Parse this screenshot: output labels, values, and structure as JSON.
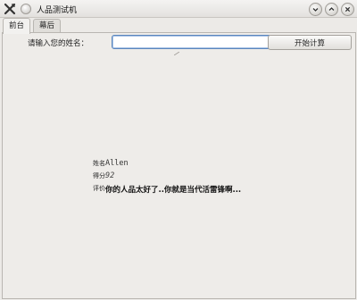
{
  "window": {
    "title": "人品测试机",
    "icons": {
      "app": "x-tools-icon",
      "menu": "menu-dot-icon",
      "minimize": "chevron-down-icon",
      "maximize": "chevron-up-icon",
      "close": "close-icon"
    }
  },
  "tabs": [
    {
      "label": "前台",
      "active": true
    },
    {
      "label": "幕后",
      "active": false
    }
  ],
  "form": {
    "prompt": "请输入您的姓名：",
    "input_value": "",
    "button_label": "开始计算"
  },
  "result": {
    "name_label": "姓名",
    "name_value": "Allen",
    "score_label": "得分",
    "score_value": "92",
    "comment_label": "评价",
    "comment_value": "你的人品太好了..你就是当代活雷锋啊..."
  },
  "colors": {
    "focus_border": "#5b86bc",
    "window_bg": "#eceae7"
  }
}
